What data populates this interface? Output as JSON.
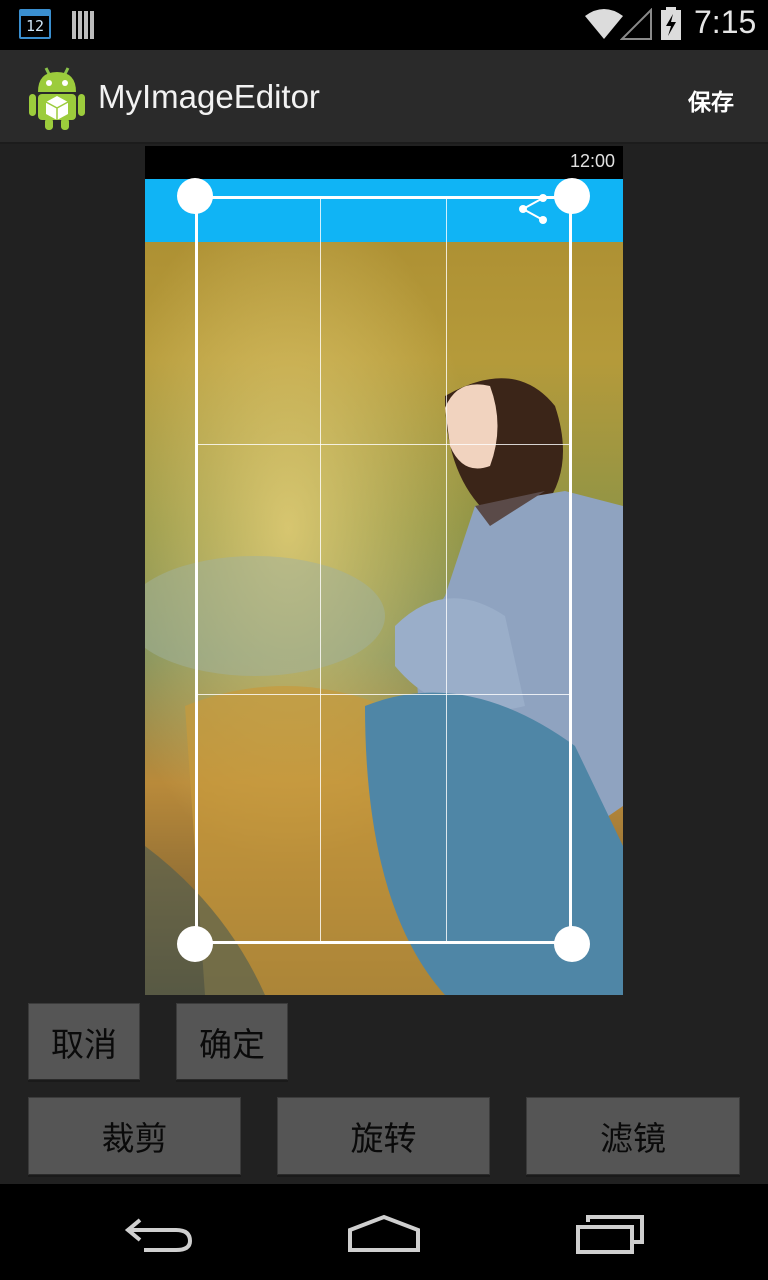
{
  "status_bar": {
    "time": "7:15",
    "calendar_day": "12"
  },
  "action_bar": {
    "title": "MyImageEditor",
    "save_label": "保存"
  },
  "preview": {
    "inner_time": "12:00"
  },
  "crop_actions": {
    "cancel_label": "取消",
    "confirm_label": "确定"
  },
  "tools": {
    "crop_label": "裁剪",
    "rotate_label": "旋转",
    "filter_label": "滤镜"
  },
  "colors": {
    "accent": "#10b4f5",
    "background": "#212121",
    "button": "#555555"
  },
  "icons": [
    "calendar-icon",
    "storage-icon",
    "wifi-icon",
    "signal-icon",
    "battery-icon",
    "android-app-icon",
    "share-icon",
    "back-icon",
    "home-icon",
    "recents-icon"
  ]
}
